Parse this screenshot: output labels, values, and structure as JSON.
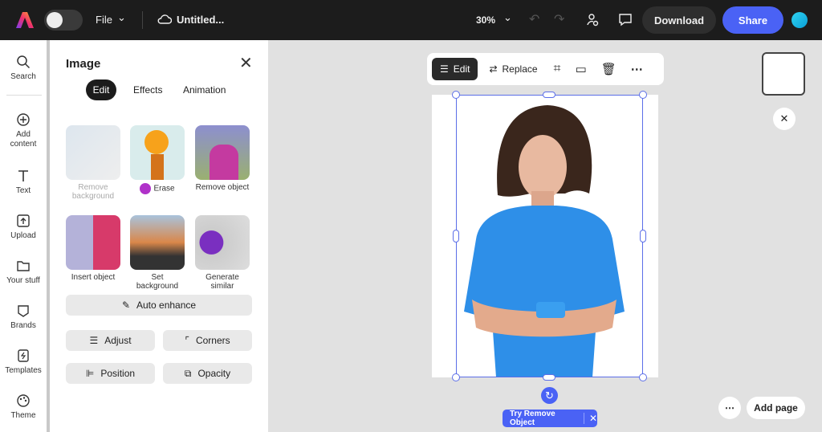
{
  "topbar": {
    "file": "File",
    "doc_title": "Untitled...",
    "zoom": "30%",
    "download": "Download",
    "share": "Share"
  },
  "rail": [
    {
      "label": "Search"
    },
    {
      "label": "Add content"
    },
    {
      "label": "Text"
    },
    {
      "label": "Upload"
    },
    {
      "label": "Your stuff"
    },
    {
      "label": "Brands"
    },
    {
      "label": "Templates"
    },
    {
      "label": "Theme"
    }
  ],
  "panel": {
    "title": "Image",
    "tabs": [
      "Edit",
      "Effects",
      "Animation"
    ],
    "tiles": [
      {
        "label": "Remove background"
      },
      {
        "label": "Erase"
      },
      {
        "label": "Remove object"
      },
      {
        "label": "Insert object"
      },
      {
        "label": "Set background"
      },
      {
        "label": "Generate similar"
      }
    ],
    "auto_enhance": "Auto enhance",
    "adjust": "Adjust",
    "corners": "Corners",
    "position": "Position",
    "opacity": "Opacity"
  },
  "toolbar": {
    "edit": "Edit",
    "replace": "Replace"
  },
  "canvas": {
    "try_remove": "Try Remove Object",
    "add_page": "Add page"
  },
  "colors": {
    "accent": "#4a62f5",
    "topbar": "#1c1c1c",
    "shirt": "#2e8fe8"
  }
}
